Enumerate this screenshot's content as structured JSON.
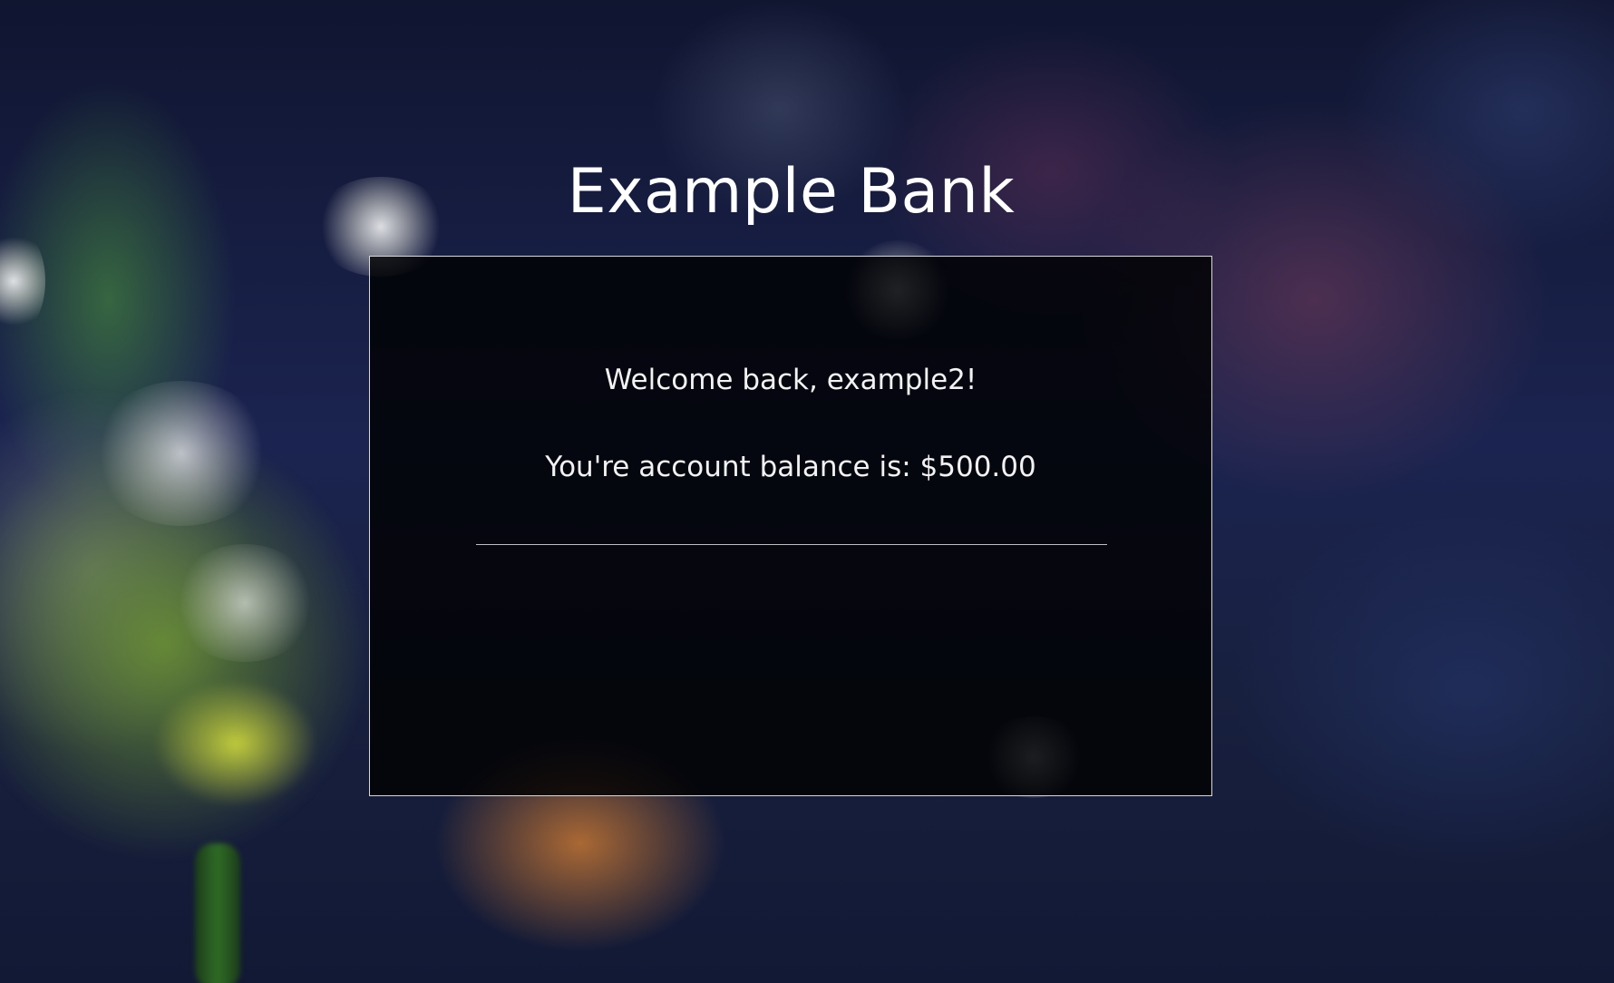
{
  "page": {
    "title": "Example Bank"
  },
  "account": {
    "welcome_prefix": "Welcome back, ",
    "username": "example2",
    "welcome_suffix": "!",
    "welcome_text": "Welcome back, example2!",
    "balance_label": "You're account balance is: ",
    "balance_value": "$500.00",
    "balance_text": "You're account balance is: $500.00"
  },
  "colors": {
    "panel_background": "#000000",
    "panel_border": "#d9d9d9",
    "text": "#ffffff"
  }
}
